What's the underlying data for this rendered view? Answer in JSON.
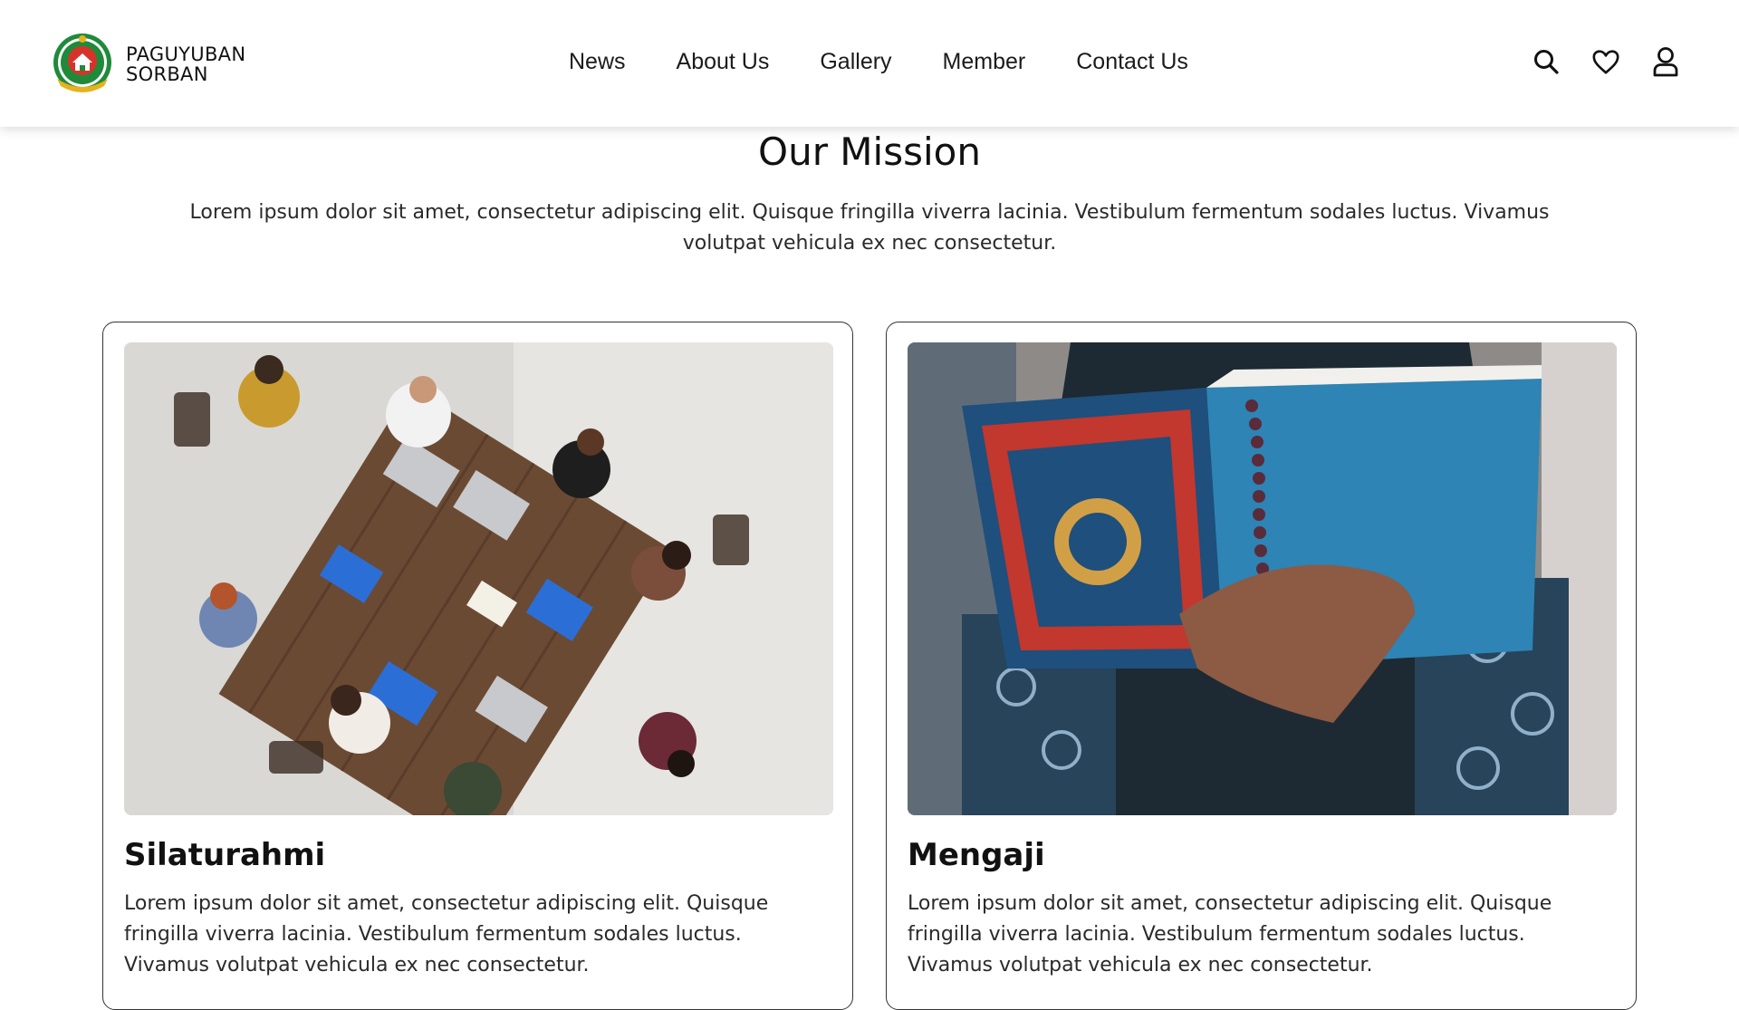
{
  "header": {
    "brand_line1": "PAGUYUBAN",
    "brand_line2": "SORBAN",
    "nav": [
      "News",
      "About Us",
      "Gallery",
      "Member",
      "Contact Us"
    ],
    "icons": [
      "search-icon",
      "heart-icon",
      "user-icon"
    ]
  },
  "mission": {
    "title": "Our Mission",
    "text": "Lorem ipsum dolor sit amet, consectetur adipiscing elit. Quisque fringilla viverra lacinia. Vestibulum fermentum sodales luctus. Vivamus volutpat vehicula ex nec consectetur."
  },
  "cards": [
    {
      "title": "Silaturahmi",
      "text": "Lorem ipsum dolor sit amet, consectetur adipiscing elit. Quisque fringilla viverra lacinia. Vestibulum fermentum sodales luctus. Vivamus volutpat vehicula ex nec consectetur."
    },
    {
      "title": "Mengaji",
      "text": "Lorem ipsum dolor sit amet, consectetur adipiscing elit. Quisque fringilla viverra lacinia. Vestibulum fermentum sodales luctus. Vivamus volutpat vehicula ex nec consectetur."
    }
  ],
  "colors": {
    "logo_green": "#1f8a3a",
    "logo_red": "#d8332a",
    "logo_gold": "#e7b21d"
  }
}
